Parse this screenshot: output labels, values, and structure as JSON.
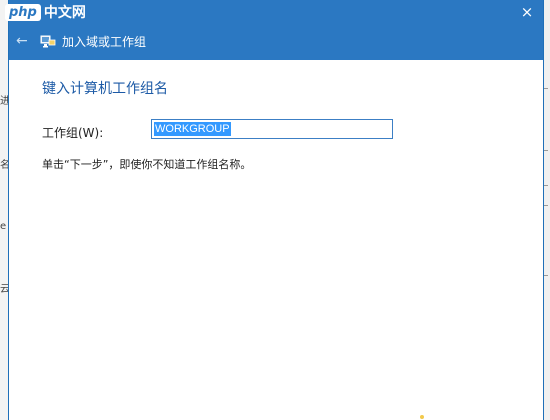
{
  "watermark": {
    "badge": "php",
    "text": "中文网"
  },
  "titlebar": {
    "close_glyph": "×",
    "back_glyph": "←",
    "title": "加入域或工作组"
  },
  "background": {
    "left_fragments": [
      "进",
      "名",
      "e",
      "云"
    ]
  },
  "main": {
    "heading": "键入计算机工作组名",
    "workgroup_label": "工作组(W):",
    "workgroup_value": "WORKGROUP",
    "hint": "单击“下一步”，即使你不知道工作组名称。"
  },
  "colors": {
    "titlebar": "#2b78c2",
    "heading": "#1c5aa6",
    "selection": "#3399ff"
  },
  "icons": [
    "back-arrow-icon",
    "network-computer-icon",
    "close-icon"
  ]
}
